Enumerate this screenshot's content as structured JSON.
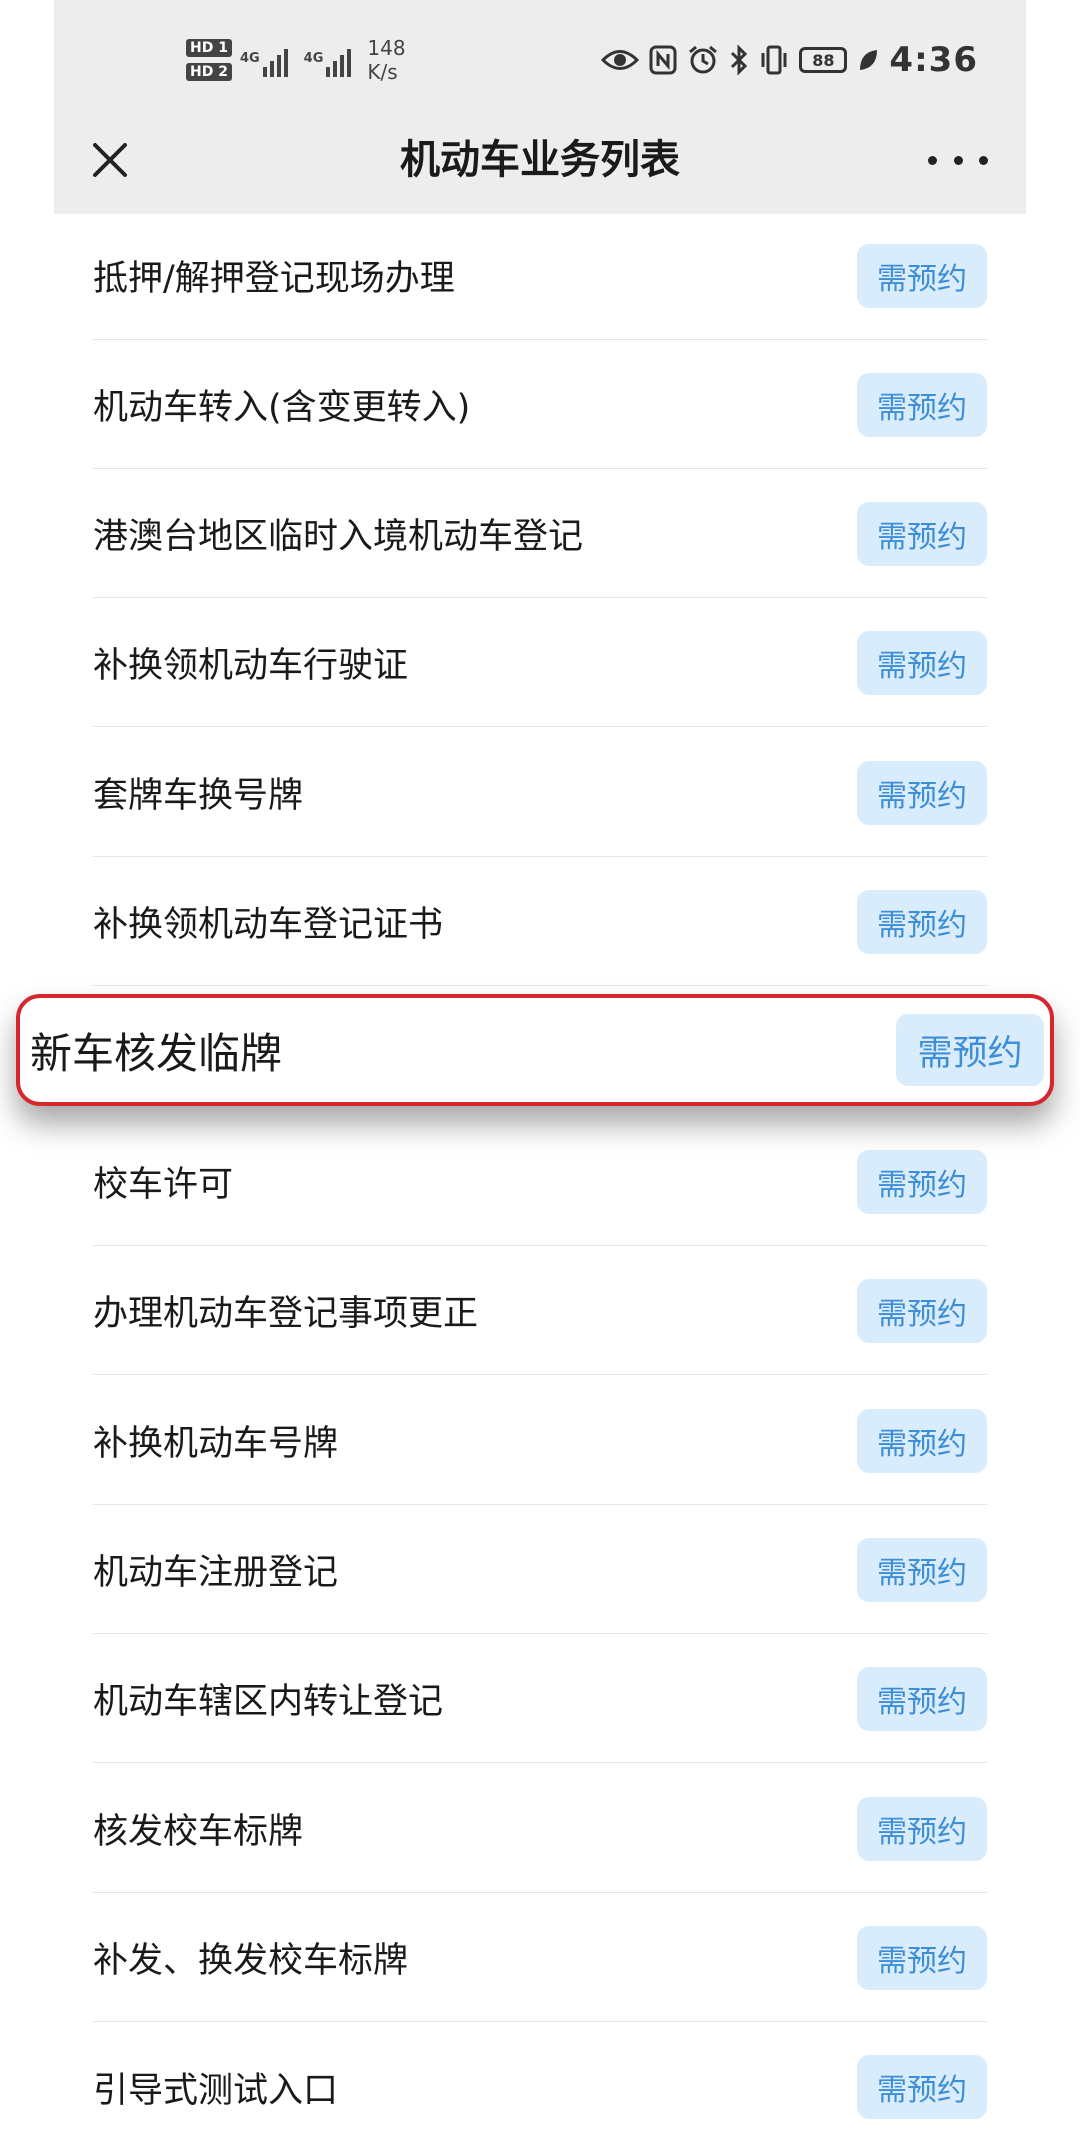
{
  "status_bar": {
    "hd1": "HD 1",
    "hd2": "HD 2",
    "net1": "4G",
    "net2": "4G",
    "speed_value": "148",
    "speed_unit": "K/s",
    "battery": "88",
    "time": "4:36",
    "icons": [
      "eye-icon",
      "nfc-icon",
      "alarm-icon",
      "bluetooth-icon",
      "vibrate-icon",
      "battery-icon",
      "leaf-icon"
    ]
  },
  "nav": {
    "title": "机动车业务列表",
    "close_icon": "close-icon",
    "more_icon": "more-icon"
  },
  "items": [
    {
      "label": "抵押/解押登记现场办理",
      "badge": "需预约"
    },
    {
      "label": "机动车转入(含变更转入)",
      "badge": "需预约"
    },
    {
      "label": "港澳台地区临时入境机动车登记",
      "badge": "需预约"
    },
    {
      "label": "补换领机动车行驶证",
      "badge": "需预约"
    },
    {
      "label": "套牌车换号牌",
      "badge": "需预约"
    },
    {
      "label": "补换领机动车登记证书",
      "badge": "需预约"
    },
    {
      "label": "新车核发临牌",
      "badge": "需预约"
    },
    {
      "label": "校车许可",
      "badge": "需预约"
    },
    {
      "label": "办理机动车登记事项更正",
      "badge": "需预约"
    },
    {
      "label": "补换机动车号牌",
      "badge": "需预约"
    },
    {
      "label": "机动车注册登记",
      "badge": "需预约"
    },
    {
      "label": "机动车辖区内转让登记",
      "badge": "需预约"
    },
    {
      "label": "核发校车标牌",
      "badge": "需预约"
    },
    {
      "label": "补发、换发校车标牌",
      "badge": "需预约"
    },
    {
      "label": "引导式测试入口",
      "badge": "需预约"
    }
  ],
  "colors": {
    "badge_bg": "#d9ecfb",
    "badge_text": "#3d8ed6",
    "highlight_border": "#d6262e",
    "header_bg": "#ededed"
  }
}
